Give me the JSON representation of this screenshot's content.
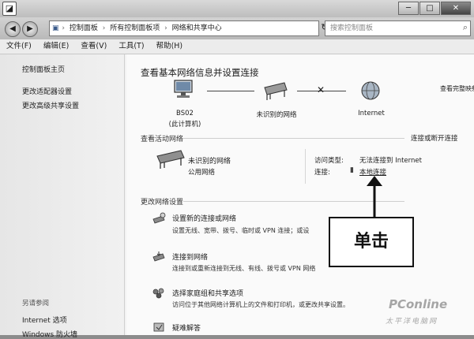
{
  "titlebar": {
    "app_icon_glyph": "◪",
    "buttons": {
      "minimize": "─",
      "maximize": "□",
      "close": "✕"
    }
  },
  "address": {
    "back": "◀",
    "forward": "▶",
    "breadcrumbs": [
      "控制面板",
      "所有控制面板项",
      "网络和共享中心"
    ],
    "refresh": "↻",
    "search_placeholder": "搜索控制面板"
  },
  "menubar": {
    "items": [
      "文件(F)",
      "编辑(E)",
      "查看(V)",
      "工具(T)",
      "帮助(H)"
    ]
  },
  "sidebar": {
    "home": "控制面板主页",
    "links": [
      "更改适配器设置",
      "更改高级共享设置"
    ],
    "see_also_label": "另请参阅",
    "see_also_links": [
      "Internet 选项",
      "Windows 防火墙"
    ]
  },
  "main": {
    "title": "查看基本网络信息并设置连接",
    "full_map": "查看完整映射",
    "map": {
      "nodes": [
        {
          "label": "BS02",
          "sub": "(此计算机)",
          "icon": "computer-icon"
        },
        {
          "label": "未识别的网络",
          "sub": "",
          "icon": "network-bench-icon"
        },
        {
          "label": "Internet",
          "sub": "",
          "icon": "globe-icon"
        }
      ],
      "broken_link_glyph": "✕"
    },
    "active": {
      "heading": "查看活动网络",
      "action": "连接或断开连接",
      "network_name": "未识别的网络",
      "network_type": "公用网络",
      "access_type_label": "访问类型:",
      "access_type_value": "无法连接到 Internet",
      "connections_label": "连接:",
      "connection_value": "本地连接"
    },
    "change": {
      "heading": "更改网络设置",
      "tasks": [
        {
          "title": "设置新的连接或网络",
          "desc": "设置无线、宽带、拨号、临时或 VPN 连接；或设",
          "icon": "new-connection-icon"
        },
        {
          "title": "连接到网络",
          "desc": "连接到或重新连接到无线、有线、拨号或 VPN 网络",
          "icon": "connect-network-icon"
        },
        {
          "title": "选择家庭组和共享选项",
          "desc": "访问位于其他网络计算机上的文件和打印机，或更改共享设置。",
          "icon": "homegroup-icon"
        },
        {
          "title": "疑难解答",
          "desc": "",
          "icon": "troubleshoot-icon"
        }
      ]
    }
  },
  "callout": {
    "text": "单击"
  },
  "watermark": {
    "brand": "PConline",
    "sub": "太平洋电脑网"
  }
}
